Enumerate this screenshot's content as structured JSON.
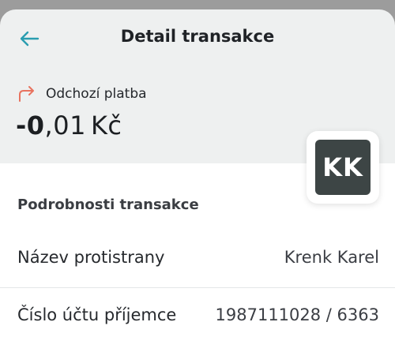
{
  "header": {
    "title": "Detail transakce",
    "back_icon": "arrow-left-icon",
    "accent": "#2a9db0"
  },
  "summary": {
    "direction_icon": "outgoing-arrow-icon",
    "direction_color": "#e8735f",
    "direction_label": "Odchozí platba",
    "amount_major": "-0",
    "amount_minor": ",01",
    "currency": "Kč"
  },
  "avatar": {
    "initials": "KK"
  },
  "details": {
    "section_title": "Podrobnosti transakce",
    "rows": [
      {
        "label": "Název protistrany",
        "value": "Krenk Karel"
      },
      {
        "label": "Číslo účtu příjemce",
        "value": "1987111028 / 6363"
      }
    ]
  }
}
